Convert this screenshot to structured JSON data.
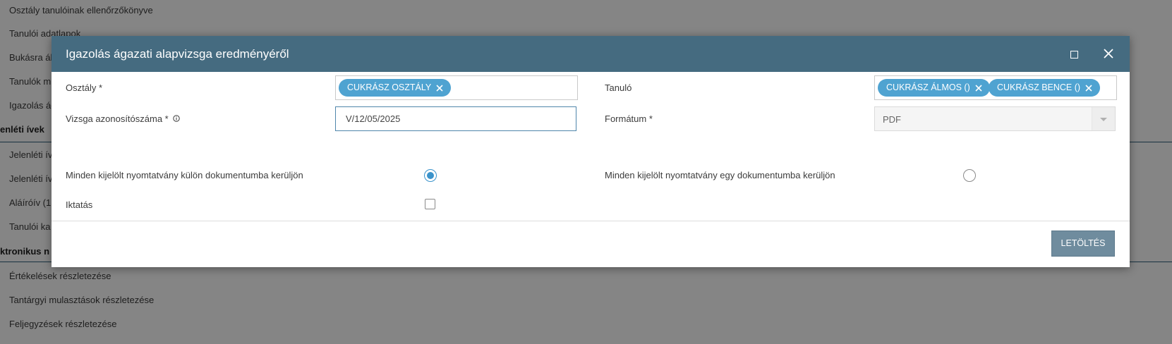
{
  "background": {
    "items_top": [
      "Osztály tanulóinak ellenőrzőkönyve",
      "Tanulói adatlapok",
      "Bukásra ál",
      "Tanulók m",
      "Igazolás ág"
    ],
    "section1": "enléti ívek",
    "items_mid": [
      "Jelenléti ív",
      "Jelenléti ív",
      "Aláíróív (1",
      "Tanulói ka"
    ],
    "section2": "ktronikus n",
    "items_bottom": [
      "Értékelések részletezése",
      "Tantárgyi mulasztások részletezése",
      "Feljegyzések részletezése"
    ]
  },
  "modal": {
    "title": "Igazolás ágazati alapvizsga eredményéről",
    "fields": {
      "osztaly_label": "Osztály *",
      "osztaly_tags": [
        "CUKRÁSZ OSZTÁLY"
      ],
      "tanulo_label": "Tanuló",
      "tanulo_tags": [
        "CUKRÁSZ ÁLMOS ()",
        "CUKRÁSZ BENCE ()"
      ],
      "vizsga_label": "Vizsga azonosítószáma *",
      "vizsga_value": "V/12/05/2025",
      "formatum_label": "Formátum *",
      "formatum_value": "PDF",
      "kulon_label": "Minden kijelölt nyomtatvány külön dokumentumba kerüljön",
      "egy_label": "Minden kijelölt nyomtatvány egy dokumentumba kerüljön",
      "iktatas_label": "Iktatás"
    },
    "state": {
      "kulon_selected": true,
      "egy_selected": false,
      "iktatas_checked": false
    },
    "download_label": "LETÖLTÉS"
  },
  "colors": {
    "header_bg": "#456b80",
    "tag_bg": "#4fa3d1",
    "radio_accent": "#3a93cb",
    "button_bg": "#6f8c9e"
  },
  "icons": {
    "maximize": "maximize-icon",
    "close": "close-icon",
    "tag_remove": "x-icon",
    "info": "info-icon",
    "dropdown": "chevron-down-icon"
  }
}
